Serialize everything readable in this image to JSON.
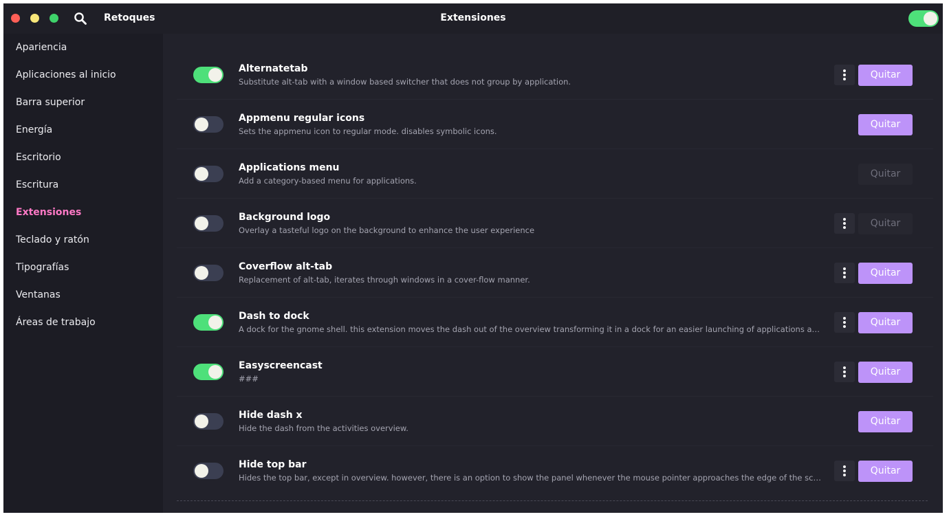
{
  "header": {
    "app_title": "Retoques",
    "page_title": "Extensiones",
    "global_switch_on": true
  },
  "icons": {
    "search": "magnifier",
    "more": "vertical-ellipsis"
  },
  "colors": {
    "accent_active": "#ff79c6",
    "toggle_on": "#4ee07a",
    "quit_button": "#bd93f9",
    "window_bg": "#22222b"
  },
  "sidebar": {
    "items": [
      {
        "label": "Apariencia",
        "active": false
      },
      {
        "label": "Aplicaciones al inicio",
        "active": false
      },
      {
        "label": "Barra superior",
        "active": false
      },
      {
        "label": "Energía",
        "active": false
      },
      {
        "label": "Escritorio",
        "active": false
      },
      {
        "label": "Escritura",
        "active": false
      },
      {
        "label": "Extensiones",
        "active": true
      },
      {
        "label": "Teclado y ratón",
        "active": false
      },
      {
        "label": "Tipografías",
        "active": false
      },
      {
        "label": "Ventanas",
        "active": false
      },
      {
        "label": "Áreas de trabajo",
        "active": false
      }
    ]
  },
  "extensions": [
    {
      "name": "Alternatetab",
      "description": "Substitute alt-tab with a window based switcher that does not group by application.",
      "enabled": true,
      "has_settings": true,
      "quit_label": "Quitar",
      "quit_enabled": true
    },
    {
      "name": "Appmenu regular icons",
      "description": "Sets the appmenu icon to regular mode. disables symbolic icons.",
      "enabled": false,
      "has_settings": false,
      "quit_label": "Quitar",
      "quit_enabled": true
    },
    {
      "name": "Applications menu",
      "description": "Add a category-based menu for applications.",
      "enabled": false,
      "has_settings": false,
      "quit_label": "Quitar",
      "quit_enabled": false
    },
    {
      "name": "Background logo",
      "description": "Overlay a tasteful logo on the background to enhance the user experience",
      "enabled": false,
      "has_settings": true,
      "quit_label": "Quitar",
      "quit_enabled": false
    },
    {
      "name": "Coverflow alt-tab",
      "description": "Replacement of alt-tab, iterates through windows in a cover-flow manner.",
      "enabled": false,
      "has_settings": true,
      "quit_label": "Quitar",
      "quit_enabled": true
    },
    {
      "name": "Dash to dock",
      "description": "A dock for the gnome shell. this extension moves the dash out of the overview transforming it in a dock for an easier launching of applications and a faster switching between windows and desktops.",
      "enabled": true,
      "has_settings": true,
      "quit_label": "Quitar",
      "quit_enabled": true
    },
    {
      "name": "Easyscreencast",
      "description": "###",
      "enabled": true,
      "has_settings": true,
      "quit_label": "Quitar",
      "quit_enabled": true
    },
    {
      "name": "Hide dash x",
      "description": "Hide the dash from the activities overview.",
      "enabled": false,
      "has_settings": false,
      "quit_label": "Quitar",
      "quit_enabled": true
    },
    {
      "name": "Hide top bar",
      "description": "Hides the top bar, except in overview. however, there is an option to show the panel whenever the mouse pointer approaches the edge of the screen. and if \"intellihide\" is enabled, the panel only hides when a window takes the space.",
      "enabled": false,
      "has_settings": true,
      "quit_label": "Quitar",
      "quit_enabled": true
    }
  ]
}
